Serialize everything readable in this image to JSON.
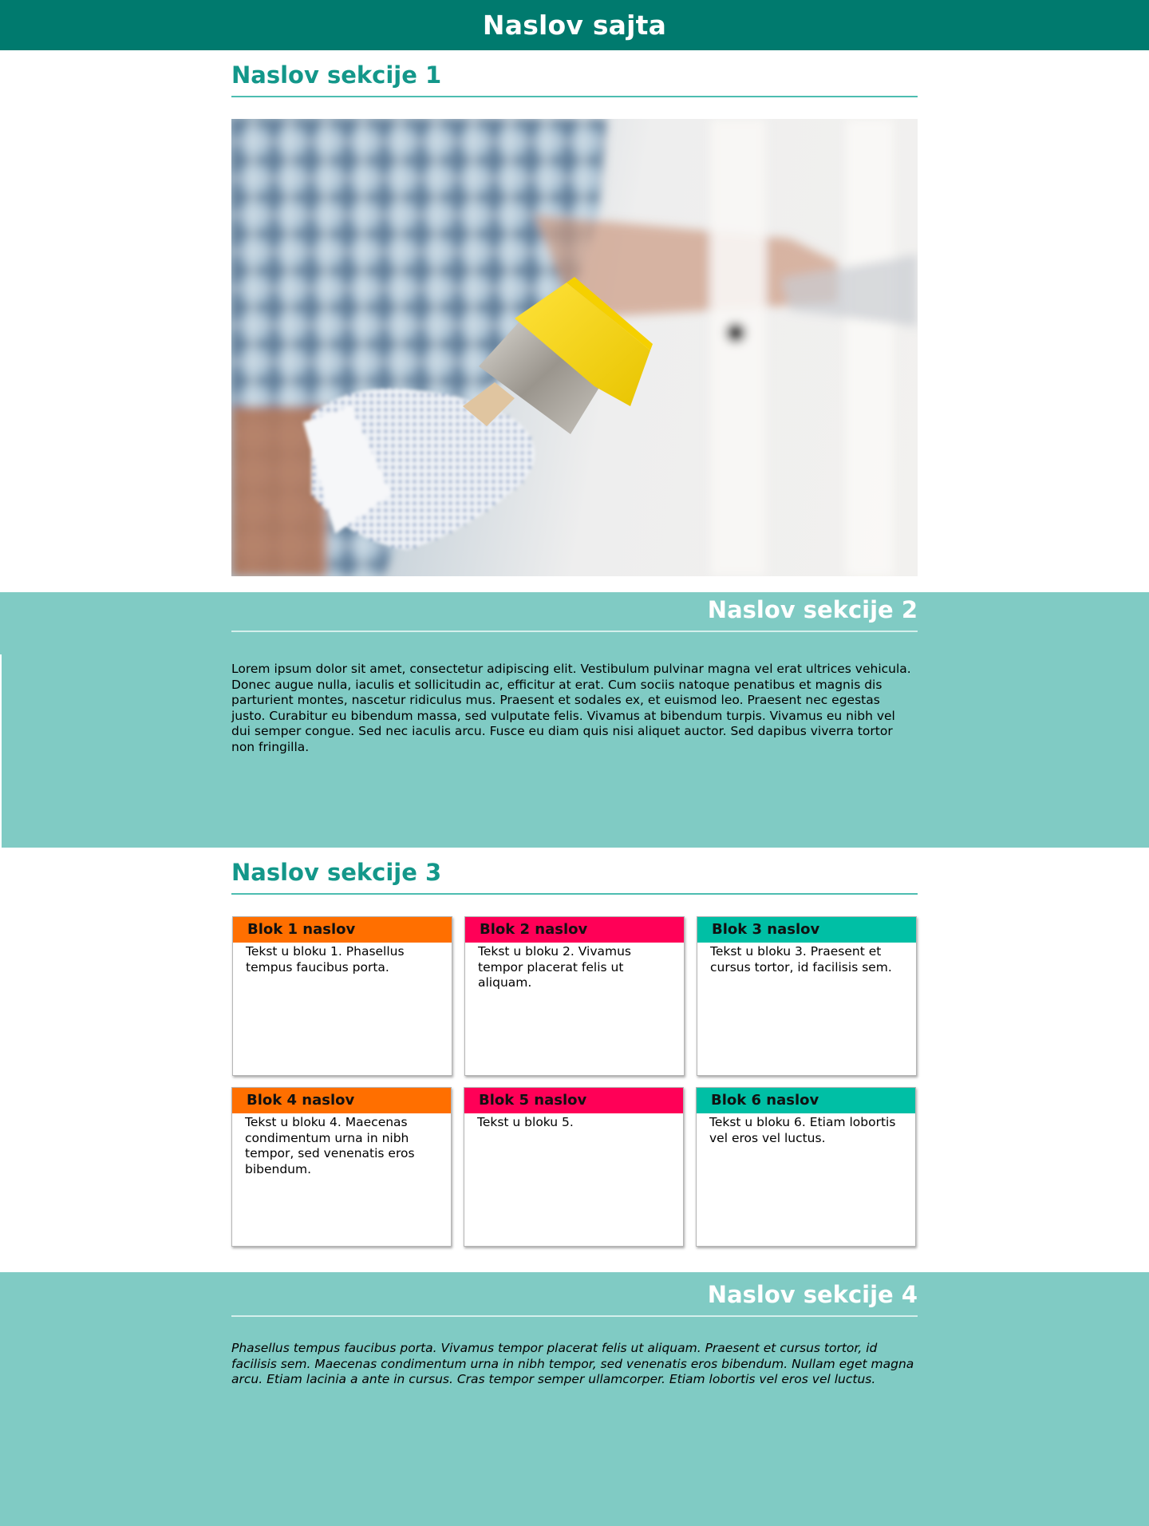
{
  "site": {
    "title": "Naslov sajta"
  },
  "sections": {
    "s1": {
      "title": "Naslov sekcije 1"
    },
    "s2": {
      "title": "Naslov sekcije 2",
      "text": "Lorem ipsum dolor sit amet, consectetur adipiscing elit. Vestibulum pulvinar magna vel erat ultrices vehicula. Donec augue nulla, iaculis et sollicitudin ac, efficitur at erat. Cum sociis natoque penatibus et magnis dis parturient montes, nascetur ridiculus mus. Praesent et sodales ex, et euismod leo. Praesent nec egestas justo. Curabitur eu bibendum massa, sed vulputate felis. Vivamus at bibendum turpis. Vivamus eu nibh vel dui semper congue. Sed nec iaculis arcu. Fusce eu diam quis nisi aliquet auctor. Sed dapibus viverra tortor non fringilla."
    },
    "s3": {
      "title": "Naslov sekcije 3",
      "blocks": [
        {
          "title": "Blok 1 naslov",
          "text": "Tekst u bloku 1. Phasellus tempus faucibus porta.",
          "color": "#ff6f00"
        },
        {
          "title": "Blok 2 naslov",
          "text": "Tekst u bloku 2. Vivamus tempor placerat felis ut aliquam.",
          "color": "#ff0057"
        },
        {
          "title": "Blok 3 naslov",
          "text": "Tekst u bloku 3. Praesent et cursus tortor, id facilisis sem.",
          "color": "#00bfa5"
        },
        {
          "title": "Blok 4 naslov",
          "text": "Tekst u bloku 4. Maecenas condimentum urna in nibh tempor, sed venenatis eros bibendum.",
          "color": "#ff6f00"
        },
        {
          "title": "Blok 5 naslov",
          "text": "Tekst u bloku 5.",
          "color": "#ff0057"
        },
        {
          "title": "Blok 6 naslov",
          "text": "Tekst u bloku 6. Etiam lobortis vel eros vel luctus.",
          "color": "#00bfa5"
        }
      ]
    },
    "s4": {
      "title": "Naslov sekcije 4",
      "text": "Phasellus tempus faucibus porta. Vivamus tempor placerat felis ut aliquam. Praesent et cursus tortor, id facilisis sem. Maecenas condimentum urna in nibh tempor, sed venenatis eros bibendum. Nullam eget magna arcu. Etiam lacinia a ante in cursus. Cras tempor semper ullamcorper. Etiam lobortis vel eros vel luctus."
    }
  },
  "colors": {
    "header": "#007a6e",
    "band": "#80cbc4",
    "heading": "#13978a",
    "divider": "#4dbdb1"
  }
}
